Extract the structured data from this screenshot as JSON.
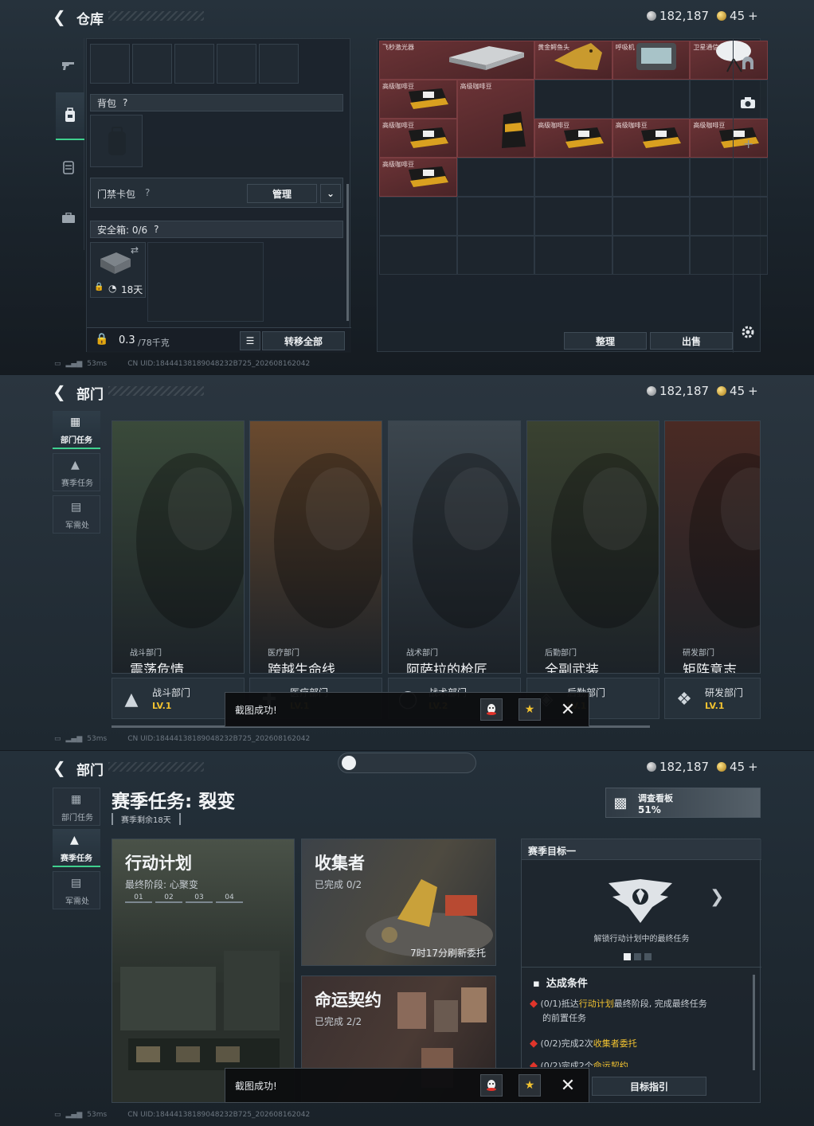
{
  "currency": {
    "silver": "182,187",
    "gold": "45",
    "gold_plus": "+"
  },
  "network": {
    "ping": "53ms",
    "uid": "CN UID:18444138189048232B725_202608162042"
  },
  "warehouse": {
    "title": "仓库",
    "backpack_label": "背包",
    "keycard_label": "门禁卡包",
    "manage_label": "管理",
    "safebox_label": "安全箱: 0/6",
    "safebox_timer": "18天",
    "weight": "0.3",
    "weight_max": "/78千克",
    "transfer_all": "转移全部",
    "sort_label": "整理",
    "sell_label": "出售",
    "help": "?",
    "items": [
      {
        "name": "飞秒激光器",
        "col": 0,
        "row": 0,
        "w": 2,
        "h": 1,
        "kind": "laser"
      },
      {
        "name": "黄金鳄鱼头",
        "col": 2,
        "row": 0,
        "w": 1,
        "h": 1,
        "kind": "croc"
      },
      {
        "name": "呼吸机",
        "col": 3,
        "row": 0,
        "w": 1,
        "h": 1,
        "kind": "vent"
      },
      {
        "name": "卫星通信",
        "col": 4,
        "row": 0,
        "w": 1,
        "h": 1,
        "kind": "sat"
      },
      {
        "name": "高级咖啡豆",
        "col": 0,
        "row": 1,
        "w": 1,
        "h": 1,
        "kind": "coffee"
      },
      {
        "name": "高级咖啡豆",
        "col": 1,
        "row": 1,
        "w": 1,
        "h": 2,
        "kind": "bag"
      },
      {
        "name": "高级咖啡豆",
        "col": 0,
        "row": 2,
        "w": 1,
        "h": 1,
        "kind": "coffee"
      },
      {
        "name": "高级咖啡豆",
        "col": 2,
        "row": 2,
        "w": 1,
        "h": 1,
        "kind": "coffee"
      },
      {
        "name": "高级咖啡豆",
        "col": 3,
        "row": 2,
        "w": 1,
        "h": 1,
        "kind": "coffee"
      },
      {
        "name": "高级咖啡豆",
        "col": 4,
        "row": 2,
        "w": 1,
        "h": 1,
        "kind": "coffee"
      },
      {
        "name": "高级咖啡豆",
        "col": 0,
        "row": 3,
        "w": 1,
        "h": 1,
        "kind": "coffee"
      }
    ]
  },
  "dept": {
    "title": "部门",
    "side": [
      {
        "label": "部门任务"
      },
      {
        "label": "赛季任务"
      },
      {
        "label": "军需处"
      }
    ],
    "cards": [
      {
        "sub": "战斗部门",
        "title": "震荡危情",
        "dept": "战斗部门",
        "lv": "LV.1",
        "bg": "#3a4a3a"
      },
      {
        "sub": "医疗部门",
        "title": "跨越生命线",
        "dept": "医疗部门",
        "lv": "LV.1",
        "bg": "#6a4a2e"
      },
      {
        "sub": "战术部门",
        "title": "阿萨拉的枪匠",
        "dept": "战术部门",
        "lv": "LV.2",
        "bg": "#3c464e"
      },
      {
        "sub": "后勤部门",
        "title": "全副武装",
        "dept": "后勤部门",
        "lv": "LV.1",
        "bg": "#3a4230"
      },
      {
        "sub": "研发部门",
        "title": "矩阵意志",
        "dept": "研发部门",
        "lv": "LV.1",
        "bg": "#4a2a24"
      }
    ],
    "toast": "截图成功!"
  },
  "season": {
    "title": "赛季任务: 裂变",
    "remaining": "赛季剩余18天",
    "board_label": "调查看板",
    "board_pct": "51%",
    "missions": {
      "plan": {
        "title": "行动计划",
        "sub": "最终阶段: 心聚变",
        "stages": [
          "01",
          "02",
          "03",
          "04"
        ]
      },
      "collector": {
        "title": "收集者",
        "sub": "已完成 0/2",
        "refresh": "7时17分刷新委托"
      },
      "fate": {
        "title": "命运契约",
        "sub": "已完成 2/2"
      }
    },
    "goal": {
      "header": "赛季目标一",
      "caption": "解锁行动计划中的最终任务",
      "cond_header": "达成条件",
      "conds": [
        {
          "pre": "(0/1)抵达",
          "hl": "行动计划",
          "post": "最终阶段, 完成最终任务",
          "line2": "的前置任务"
        },
        {
          "pre": "(0/2)完成2次",
          "hl": "收集者委托",
          "post": "",
          "line2": ""
        },
        {
          "pre": "(0/2)完成2个",
          "hl": "命运契约",
          "post": "",
          "line2": ""
        }
      ],
      "guide": "目标指引"
    },
    "toast": "截图成功!"
  }
}
